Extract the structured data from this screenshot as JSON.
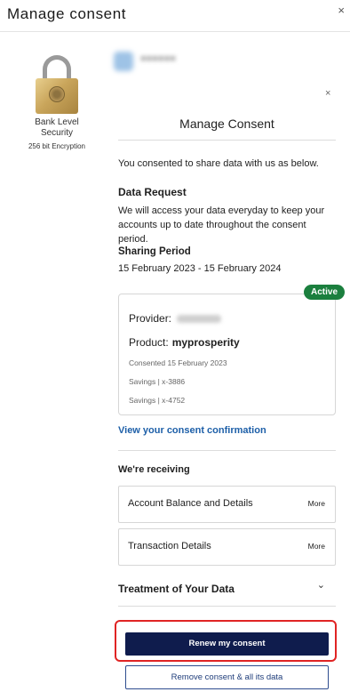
{
  "window": {
    "title": "Manage consent",
    "close_icon": "×"
  },
  "security": {
    "label_line1": "Bank Level",
    "label_line2": "Security",
    "encryption": "256 bit Encryption"
  },
  "modal": {
    "close_icon": "×",
    "title": "Manage Consent",
    "intro": "You consented to share data with us as below.",
    "data_request": {
      "heading": "Data Request",
      "body": "We will access your data everyday to keep your accounts up to date throughout the consent period."
    },
    "sharing_period": {
      "heading": "Sharing Period",
      "value": "15 February 2023 - 15 February 2024"
    },
    "consent_card": {
      "status": "Active",
      "status_color": "#1b7f3e",
      "provider_label": "Provider:",
      "product_label": "Product:",
      "product_value": "myprosperity",
      "consented": "Consented 15 February 2023",
      "accounts": [
        "Savings | x-3886",
        "Savings | x-4752"
      ]
    },
    "confirmation_link": "View your consent confirmation",
    "receiving": {
      "heading": "We're receiving",
      "items": [
        {
          "label": "Account Balance and Details",
          "more": "More"
        },
        {
          "label": "Transaction Details",
          "more": "More"
        }
      ]
    },
    "treatment": {
      "label": "Treatment of Your Data",
      "chevron_icon": "chevron-down-icon"
    },
    "buttons": {
      "renew": "Renew my consent",
      "remove": "Remove consent & all its data"
    },
    "colors": {
      "primary_button": "#0f1c4d",
      "link": "#1d5fa8",
      "highlight": "#e02424"
    }
  }
}
